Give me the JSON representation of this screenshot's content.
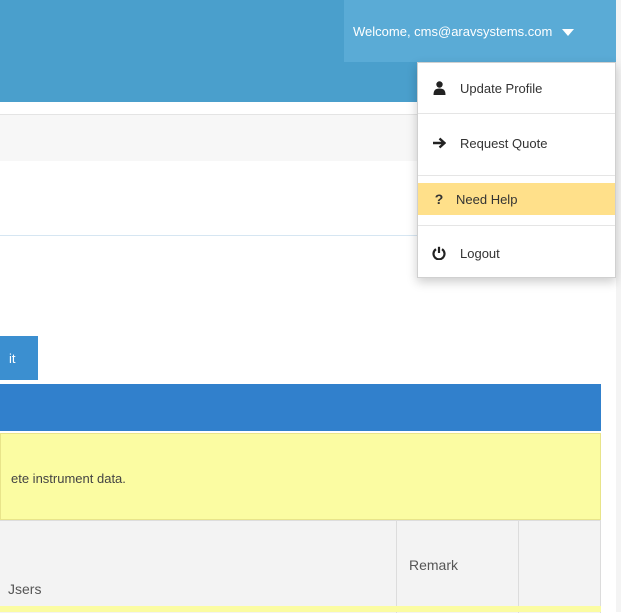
{
  "header": {
    "welcome_text": "Welcome, cms@aravsystems.com"
  },
  "user_menu": {
    "items": [
      {
        "label": "Update Profile",
        "icon": "user-icon"
      },
      {
        "label": "Request Quote",
        "icon": "arrow-right-icon"
      },
      {
        "label": "Need Help",
        "icon": "question-icon",
        "highlighted": true
      },
      {
        "label": "Logout",
        "icon": "power-icon"
      }
    ]
  },
  "toolbar": {
    "edit_button_partial": "it"
  },
  "alert": {
    "text_partial": "ete instrument data."
  },
  "table": {
    "headers": [
      "Jsers",
      "Remark",
      ""
    ]
  },
  "colors": {
    "header_blue": "#4a9fcc",
    "band_blue": "#3180cc",
    "alert_yellow": "#fbfca2",
    "menu_highlight": "#ffe08a"
  }
}
